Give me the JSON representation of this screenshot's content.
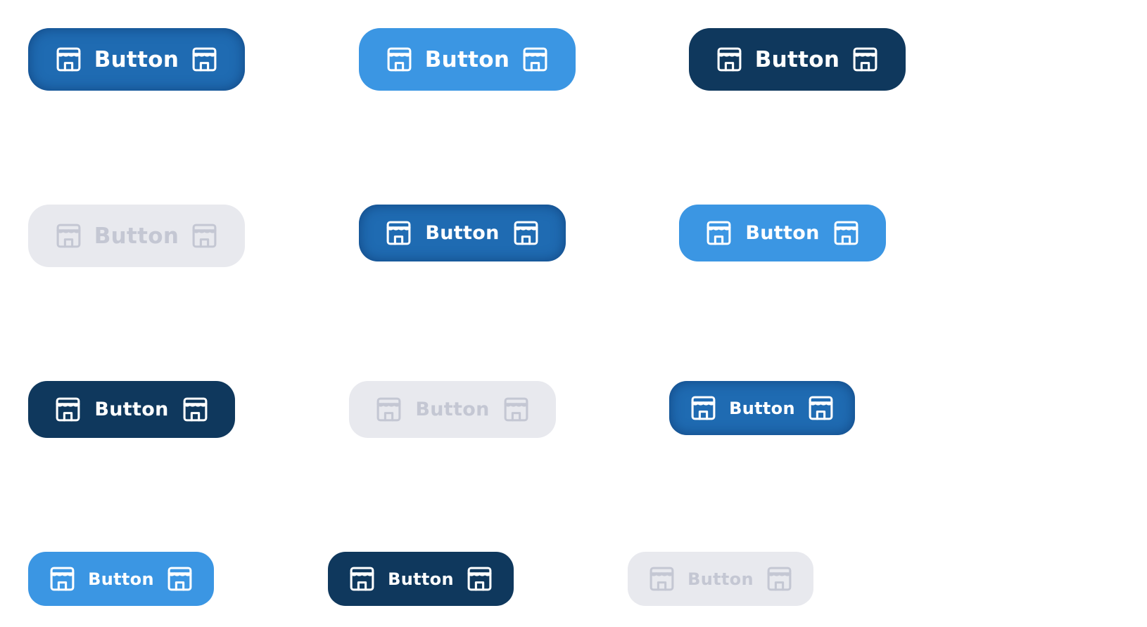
{
  "buttons": [
    {
      "label": "Button",
      "variant": "primary",
      "state": "enabled",
      "size": "large",
      "leading_icon": "storefront-icon",
      "trailing_icon": "storefront-icon"
    },
    {
      "label": "Button",
      "variant": "light",
      "state": "enabled",
      "size": "large",
      "leading_icon": "storefront-icon",
      "trailing_icon": "storefront-icon"
    },
    {
      "label": "Button",
      "variant": "dark",
      "state": "enabled",
      "size": "large",
      "leading_icon": "storefront-icon",
      "trailing_icon": "storefront-icon"
    },
    {
      "label": "Button",
      "variant": "disabled",
      "state": "disabled",
      "size": "large",
      "leading_icon": "storefront-icon",
      "trailing_icon": "storefront-icon"
    },
    {
      "label": "Button",
      "variant": "primary",
      "state": "enabled",
      "size": "medium",
      "leading_icon": "storefront-icon",
      "trailing_icon": "storefront-icon"
    },
    {
      "label": "Button",
      "variant": "light",
      "state": "enabled",
      "size": "medium",
      "leading_icon": "storefront-icon",
      "trailing_icon": "storefront-icon"
    },
    {
      "label": "Button",
      "variant": "dark",
      "state": "enabled",
      "size": "medium",
      "leading_icon": "storefront-icon",
      "trailing_icon": "storefront-icon"
    },
    {
      "label": "Button",
      "variant": "disabled",
      "state": "disabled",
      "size": "medium",
      "leading_icon": "storefront-icon",
      "trailing_icon": "storefront-icon"
    },
    {
      "label": "Button",
      "variant": "primary",
      "state": "enabled",
      "size": "small",
      "leading_icon": "storefront-icon",
      "trailing_icon": "storefront-icon"
    },
    {
      "label": "Button",
      "variant": "light",
      "state": "enabled",
      "size": "small",
      "leading_icon": "storefront-icon",
      "trailing_icon": "storefront-icon"
    },
    {
      "label": "Button",
      "variant": "dark",
      "state": "enabled",
      "size": "small",
      "leading_icon": "storefront-icon",
      "trailing_icon": "storefront-icon"
    },
    {
      "label": "Button",
      "variant": "disabled",
      "state": "disabled",
      "size": "small",
      "leading_icon": "storefront-icon",
      "trailing_icon": "storefront-icon"
    }
  ],
  "colors": {
    "primary": "#1f6bb2",
    "light": "#3b96e3",
    "dark": "#0f385d",
    "disabled_bg": "#e8e9ee",
    "disabled_fg": "#c4c7d3",
    "text": "#ffffff"
  }
}
